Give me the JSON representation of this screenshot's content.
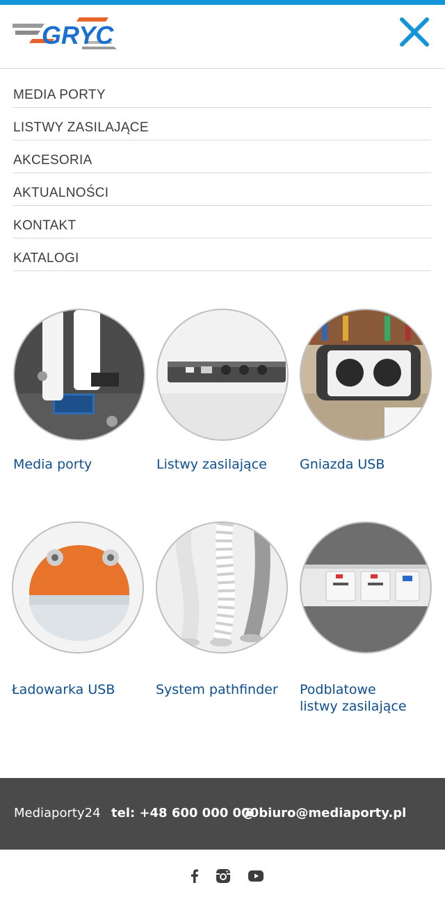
{
  "brand": {
    "logo_text": "GRYC",
    "accent_color": "#1396d8",
    "logo_orange": "#e8632a"
  },
  "header": {
    "close_icon": "close-icon"
  },
  "menu": {
    "items": [
      {
        "label": "MEDIA PORTY"
      },
      {
        "label": "LISTWY ZASILAJĄCE"
      },
      {
        "label": "AKCESORIA"
      },
      {
        "label": "AKTUALNOŚCI"
      },
      {
        "label": "KONTAKT"
      },
      {
        "label": "KATALOGI"
      }
    ]
  },
  "products": {
    "items": [
      {
        "title": "Media porty",
        "image": "usb-plugs-in-desk-image"
      },
      {
        "title": "Listwy zasilające",
        "image": "power-strip-image"
      },
      {
        "title": "Gniazda USB",
        "image": "desk-socket-usb-image"
      },
      {
        "title": "Ładowarka USB",
        "image": "orange-sphere-charger-image"
      },
      {
        "title": "System pathfinder",
        "image": "cable-spine-image"
      },
      {
        "title": "Podblatowe listwy zasilające",
        "title_line1": "Podblatowe",
        "title_line2": "listwy zasilające",
        "image": "under-desk-strip-image"
      }
    ],
    "title_color": "#0d4f91"
  },
  "footer": {
    "brand": "Mediaporty24",
    "tel": "tel: +48 600 000 000",
    "email": "@ biuro@mediaporty.pl",
    "background": "#4a4a4a"
  },
  "social": {
    "icons": [
      "facebook-icon",
      "instagram-icon",
      "youtube-icon"
    ]
  }
}
